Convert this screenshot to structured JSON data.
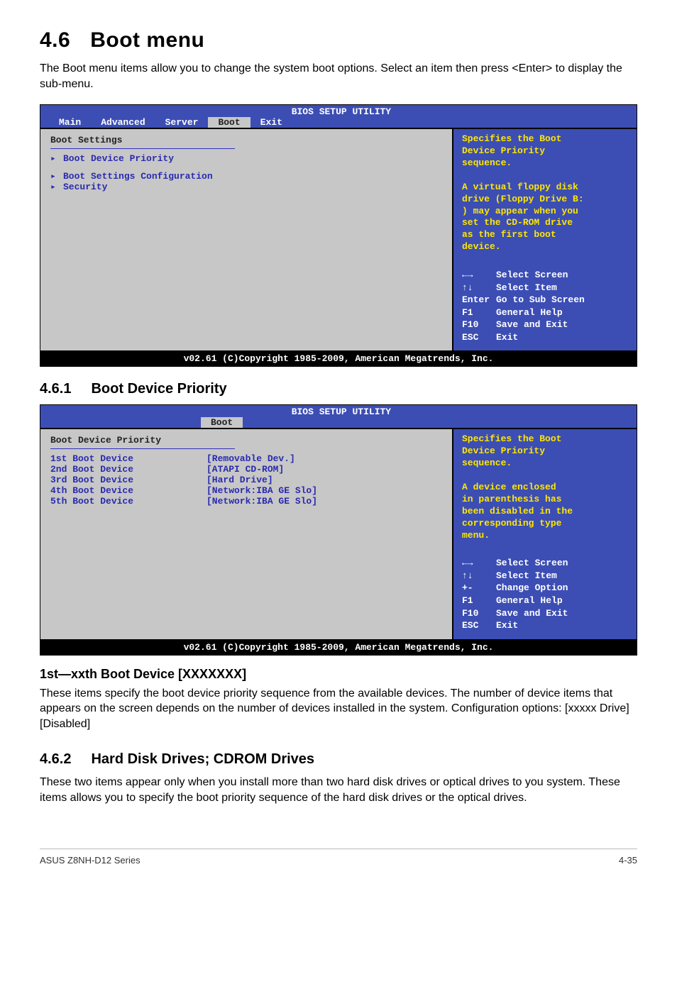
{
  "section": {
    "number": "4.6",
    "title": "Boot menu",
    "intro": "The Boot menu items allow you to change the system boot options. Select an item then press <Enter> to display the sub-menu."
  },
  "bios1": {
    "header_title": "BIOS SETUP UTILITY",
    "tabs": [
      "Main",
      "Advanced",
      "Server",
      "Boot",
      "Exit"
    ],
    "active_tab": "Boot",
    "left_title": "Boot Settings",
    "items": [
      "Boot Device Priority",
      "Boot Settings Configuration",
      "Security"
    ],
    "help_lines": [
      "Specifies the Boot",
      "Device Priority",
      "sequence.",
      "",
      "A virtual floppy disk",
      "drive (Floppy Drive B:",
      ") may appear when you",
      "set the CD-ROM drive",
      "as the first boot",
      "device."
    ],
    "keys": [
      {
        "k": "←→",
        "v": "Select Screen"
      },
      {
        "k": "↑↓",
        "v": "Select Item"
      },
      {
        "k": "Enter",
        "v": "Go to Sub Screen"
      },
      {
        "k": "F1",
        "v": "General Help"
      },
      {
        "k": "F10",
        "v": "Save and Exit"
      },
      {
        "k": "ESC",
        "v": "Exit"
      }
    ],
    "footer": "v02.61 (C)Copyright 1985-2009, American Megatrends, Inc."
  },
  "sub461": {
    "number": "4.6.1",
    "title": "Boot Device Priority"
  },
  "bios2": {
    "header_title": "BIOS SETUP UTILITY",
    "active_tab": "Boot",
    "left_title": "Boot Device Priority",
    "rows": [
      {
        "k": "1st Boot Device",
        "v": "[Removable Dev.]"
      },
      {
        "k": "2nd Boot Device",
        "v": "[ATAPI CD-ROM]"
      },
      {
        "k": "3rd Boot Device",
        "v": "[Hard Drive]"
      },
      {
        "k": "4th Boot Device",
        "v": "[Network:IBA GE Slo]"
      },
      {
        "k": "5th Boot Device",
        "v": "[Network:IBA GE Slo]"
      }
    ],
    "help_lines": [
      "Specifies the Boot",
      "Device Priority",
      "sequence.",
      "",
      "A device enclosed",
      "in parenthesis has",
      "been disabled in the",
      "corresponding type",
      "menu."
    ],
    "keys": [
      {
        "k": "←→",
        "v": "Select Screen"
      },
      {
        "k": "↑↓",
        "v": "Select Item"
      },
      {
        "k": "+-",
        "v": "Change Option"
      },
      {
        "k": "F1",
        "v": "General Help"
      },
      {
        "k": "F10",
        "v": "Save and Exit"
      },
      {
        "k": "ESC",
        "v": "Exit"
      }
    ],
    "footer": "v02.61 (C)Copyright 1985-2009, American Megatrends, Inc."
  },
  "field": {
    "title": "1st—xxth Boot Device [XXXXXXX]",
    "desc": "These items specify the boot device priority sequence from the available devices. The number of device items that appears on the screen depends on the number of devices installed in the system. Configuration options: [xxxxx Drive] [Disabled]"
  },
  "sub462": {
    "number": "4.6.2",
    "title": "Hard Disk Drives; CDROM Drives",
    "desc": "These two items appear only when you install more than two hard disk drives or optical drives to you system. These items allows you to specify the boot priority sequence of the hard disk drives or the optical drives."
  },
  "footer": {
    "left": "ASUS Z8NH-D12 Series",
    "right": "4-35"
  }
}
